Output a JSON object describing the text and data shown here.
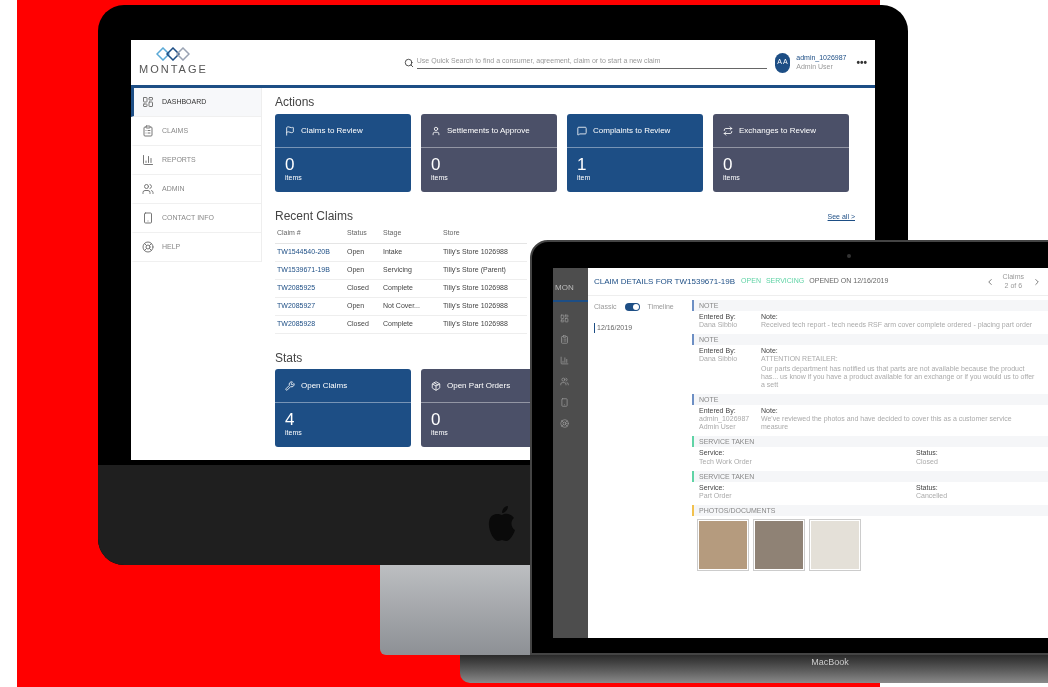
{
  "desktop": {
    "logo": "MONTAGE",
    "search": {
      "placeholder": "Use Quick Search to find a consumer, agreement, claim or to start a new claim"
    },
    "user": {
      "initials": "A A",
      "name": "admin_1026987",
      "role": "Admin User"
    },
    "more": "•••",
    "sidebar": [
      {
        "label": "DASHBOARD",
        "selected": true
      },
      {
        "label": "CLAIMS",
        "selected": false
      },
      {
        "label": "REPORTS",
        "selected": false
      },
      {
        "label": "ADMIN",
        "selected": false
      },
      {
        "label": "CONTACT INFO",
        "selected": false
      },
      {
        "label": "HELP",
        "selected": false
      }
    ],
    "actions": {
      "title": "Actions",
      "cards": [
        {
          "title": "Claims to Review",
          "count": "0",
          "unit": "items",
          "color": "#1d4e85"
        },
        {
          "title": "Settlements to Approve",
          "count": "0",
          "unit": "items",
          "color": "#4b5068"
        },
        {
          "title": "Complaints to Review",
          "count": "1",
          "unit": "item",
          "color": "#1d4e85"
        },
        {
          "title": "Exchanges to Review",
          "count": "0",
          "unit": "items",
          "color": "#4b5068"
        }
      ]
    },
    "recent": {
      "title": "Recent Claims",
      "see_all": "See all >",
      "columns": [
        "Claim #",
        "Status",
        "Stage",
        "Store"
      ],
      "rows": [
        [
          "TW1544540-20B",
          "Open",
          "Intake",
          "Tilly's Store 1026988"
        ],
        [
          "TW1539671-19B",
          "Open",
          "Servicing",
          "Tilly's Store (Parent)"
        ],
        [
          "TW2085925",
          "Closed",
          "Complete",
          "Tilly's Store 1026988"
        ],
        [
          "TW2085927",
          "Open",
          "Not Cover...",
          "Tilly's Store 1026988"
        ],
        [
          "TW2085928",
          "Closed",
          "Complete",
          "Tilly's Store 1026988"
        ]
      ]
    },
    "stats": {
      "title": "Stats",
      "cards": [
        {
          "title": "Open Claims",
          "count": "4",
          "unit": "items",
          "color": "#1d4e85"
        },
        {
          "title": "Open Part Orders",
          "count": "0",
          "unit": "items",
          "color": "#4b5068"
        }
      ]
    }
  },
  "laptop": {
    "logo": "MON",
    "title": "CLAIM DETAILS FOR TW1539671-19B",
    "status": "OPEN",
    "stage": "SERVICING",
    "opened": "OPENED ON 12/16/2019",
    "nav": {
      "label": "Claims",
      "position": "2 of 6"
    },
    "view": {
      "left": "Classic",
      "right": "Timeline",
      "on": true
    },
    "date": "12/16/2019",
    "sections": [
      {
        "kind": "note",
        "title": "NOTE",
        "color": "#6d8fc4",
        "by_label": "Entered By:",
        "by": "Dana Sibbio",
        "note_label": "Note:",
        "lines": [
          "Received tech report - tech needs RSF arm cover complete ordered - placing part order"
        ]
      },
      {
        "kind": "note",
        "title": "NOTE",
        "color": "#6d8fc4",
        "by_label": "Entered By:",
        "by": "Dana Sibbio",
        "note_label": "Note:",
        "lines": [
          "ATTENTION RETAILER:",
          "Our parts department has notified us that parts are not available because the product has... us know if you have a product available for an exchange or if you would us to offer a sett"
        ]
      },
      {
        "kind": "note",
        "title": "NOTE",
        "color": "#6d8fc4",
        "by_label": "Entered By:",
        "by": "admin_1026987 Admin User",
        "note_label": "Note:",
        "lines": [
          "We've reviewed the photos and have decided to cover this as a customer service measure"
        ]
      },
      {
        "kind": "service",
        "title": "SERVICE TAKEN",
        "color": "#5fd3a5",
        "service_label": "Service:",
        "service": "Tech Work Order",
        "status_label": "Status:",
        "status": "Closed"
      },
      {
        "kind": "service",
        "title": "SERVICE TAKEN",
        "color": "#5fd3a5",
        "service_label": "Service:",
        "service": "Part Order",
        "status_label": "Status:",
        "status": "Cancelled"
      },
      {
        "kind": "photos",
        "title": "PHOTOS/DOCUMENTS",
        "color": "#f2c14e"
      }
    ]
  },
  "brand": "MacBook"
}
